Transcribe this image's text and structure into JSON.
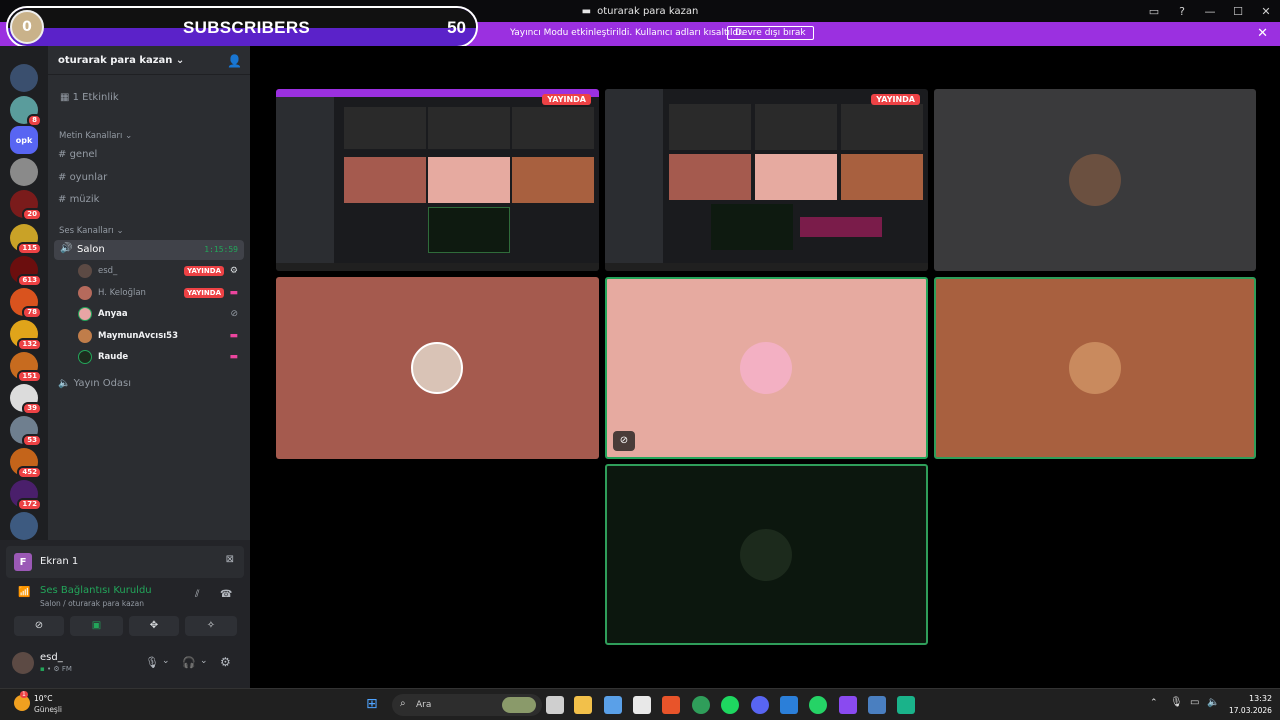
{
  "window": {
    "title": "oturarak para kazan"
  },
  "overlay": {
    "count_left": "0",
    "label": "SUBSCRIBERS",
    "count_right": "50"
  },
  "banner": {
    "message": "Yayıncı Modu etkinleştirildi. Kullanıcı adları kısaltıldı.",
    "button": "Devre dışı bırak"
  },
  "server": {
    "name": "oturarak para kazan",
    "events": "1 Etkinlik",
    "text_category": "Metin Kanalları",
    "text_channels": [
      "genel",
      "oyunlar",
      "müzik"
    ],
    "voice_category": "Ses Kanalları",
    "voice_channel": {
      "name": "Salon",
      "timer": "1:15:59"
    },
    "voice_users": [
      {
        "name": "esd_",
        "live": "YAYINDA"
      },
      {
        "name": "H. Keloğlan",
        "live": "YAYINDA"
      },
      {
        "name": "Anyaa",
        "live": ""
      },
      {
        "name": "MaymunAvcısı53",
        "live": ""
      },
      {
        "name": "Raude",
        "live": ""
      }
    ],
    "stage_channel": "Yayın Odası",
    "badges": [
      "8",
      "20",
      "115",
      "613",
      "78",
      "132",
      "151",
      "39",
      "53",
      "452",
      "172"
    ],
    "opk": "opk"
  },
  "panel": {
    "screen_label": "Ekran 1",
    "screen_letter": "F",
    "voice_status": "Ses Bağlantısı Kuruldu",
    "voice_location": "Salon / oturarak para kazan",
    "user_name": "esd_",
    "user_status": "FM"
  },
  "stage": {
    "live_tag": "YAYINDA"
  },
  "taskbar": {
    "weather_temp": "10°C",
    "weather_loc": "Güneşli",
    "search_placeholder": "Ara",
    "time": "13:32",
    "date": "17.03.2026",
    "weather_badge": "1"
  },
  "colors": {
    "accent": "#9b30e0",
    "live": "#ed4245",
    "green": "#23a55a"
  }
}
